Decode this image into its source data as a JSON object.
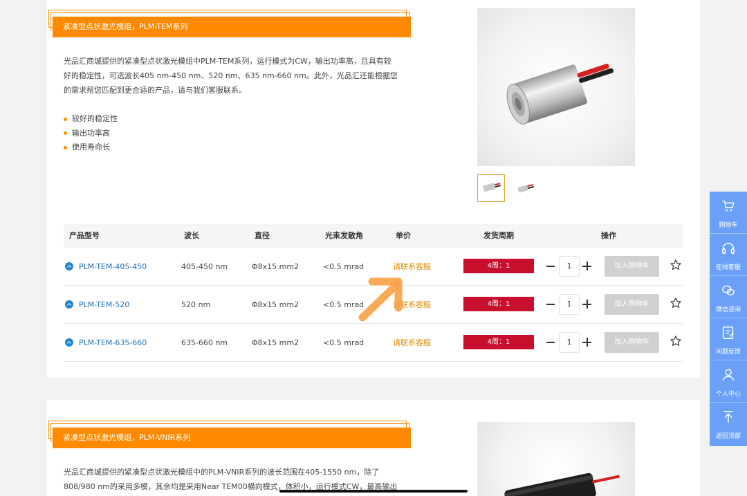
{
  "sections": [
    {
      "title": "紧凑型点状激光模组，PLM-TEM系列",
      "description": "光品汇商城提供的紧凑型点状激光模组中PLM-TEM系列，运行模式为CW，输出功率高，且具有较好的稳定性，可选波长405 nm-450 nm、520 nm、635 nm-660 nm。此外，光品汇还能根据您的需求帮您匹配到更合适的产品，请与我们客服联系。",
      "features": [
        "较好的稳定性",
        "输出功率高",
        "使用寿命长"
      ],
      "table": {
        "headers": [
          "产品型号",
          "波长",
          "直径",
          "光束发散角",
          "单价",
          "发货周期",
          "操作"
        ],
        "rows": [
          {
            "model": "PLM-TEM-405-450",
            "wavelength": "405-450 nm",
            "diameter": "Φ8x15 mm2",
            "divergence": "<0.5 mrad",
            "price": "请联系客服",
            "lead_time": "4周：1",
            "quantity": "1",
            "cart_label": "加入购物车"
          },
          {
            "model": "PLM-TEM-520",
            "wavelength": "520 nm",
            "diameter": "Φ8x15 mm2",
            "divergence": "<0.5 mrad",
            "price": "请联系客服",
            "lead_time": "4周：1",
            "quantity": "1",
            "cart_label": "加入购物车"
          },
          {
            "model": "PLM-TEM-635-660",
            "wavelength": "635-660 nm",
            "diameter": "Φ8x15 mm2",
            "divergence": "<0.5 mrad",
            "price": "请联系客服",
            "lead_time": "4周：1",
            "quantity": "1",
            "cart_label": "加入购物车"
          }
        ]
      }
    },
    {
      "title": "紧凑型点状激光模组，PLM-VNIR系列",
      "description": "光品汇商城提供的紧凑型点状激光模组中的PLM-VNIR系列的波长范围在405-1550 nm，除了808/980 nm的采用多模，其余均是采用Near TEM00横向模式，体积小，运行模式CW，最高输出"
    }
  ],
  "sidebar": {
    "items": [
      {
        "label": "购物车",
        "icon": "cart-icon"
      },
      {
        "label": "在线客服",
        "icon": "headset-icon"
      },
      {
        "label": "微信咨询",
        "icon": "wechat-icon"
      },
      {
        "label": "问题反馈",
        "icon": "feedback-icon"
      },
      {
        "label": "个人中心",
        "icon": "user-icon"
      },
      {
        "label": "返回顶部",
        "icon": "back-to-top-icon"
      }
    ]
  },
  "colors": {
    "accent_orange": "#ff8a00",
    "link_blue": "#1e6fb5",
    "lead_red": "#c8102e",
    "sidebar_blue": "#6aa0f8",
    "price_orange": "#e98b00"
  }
}
